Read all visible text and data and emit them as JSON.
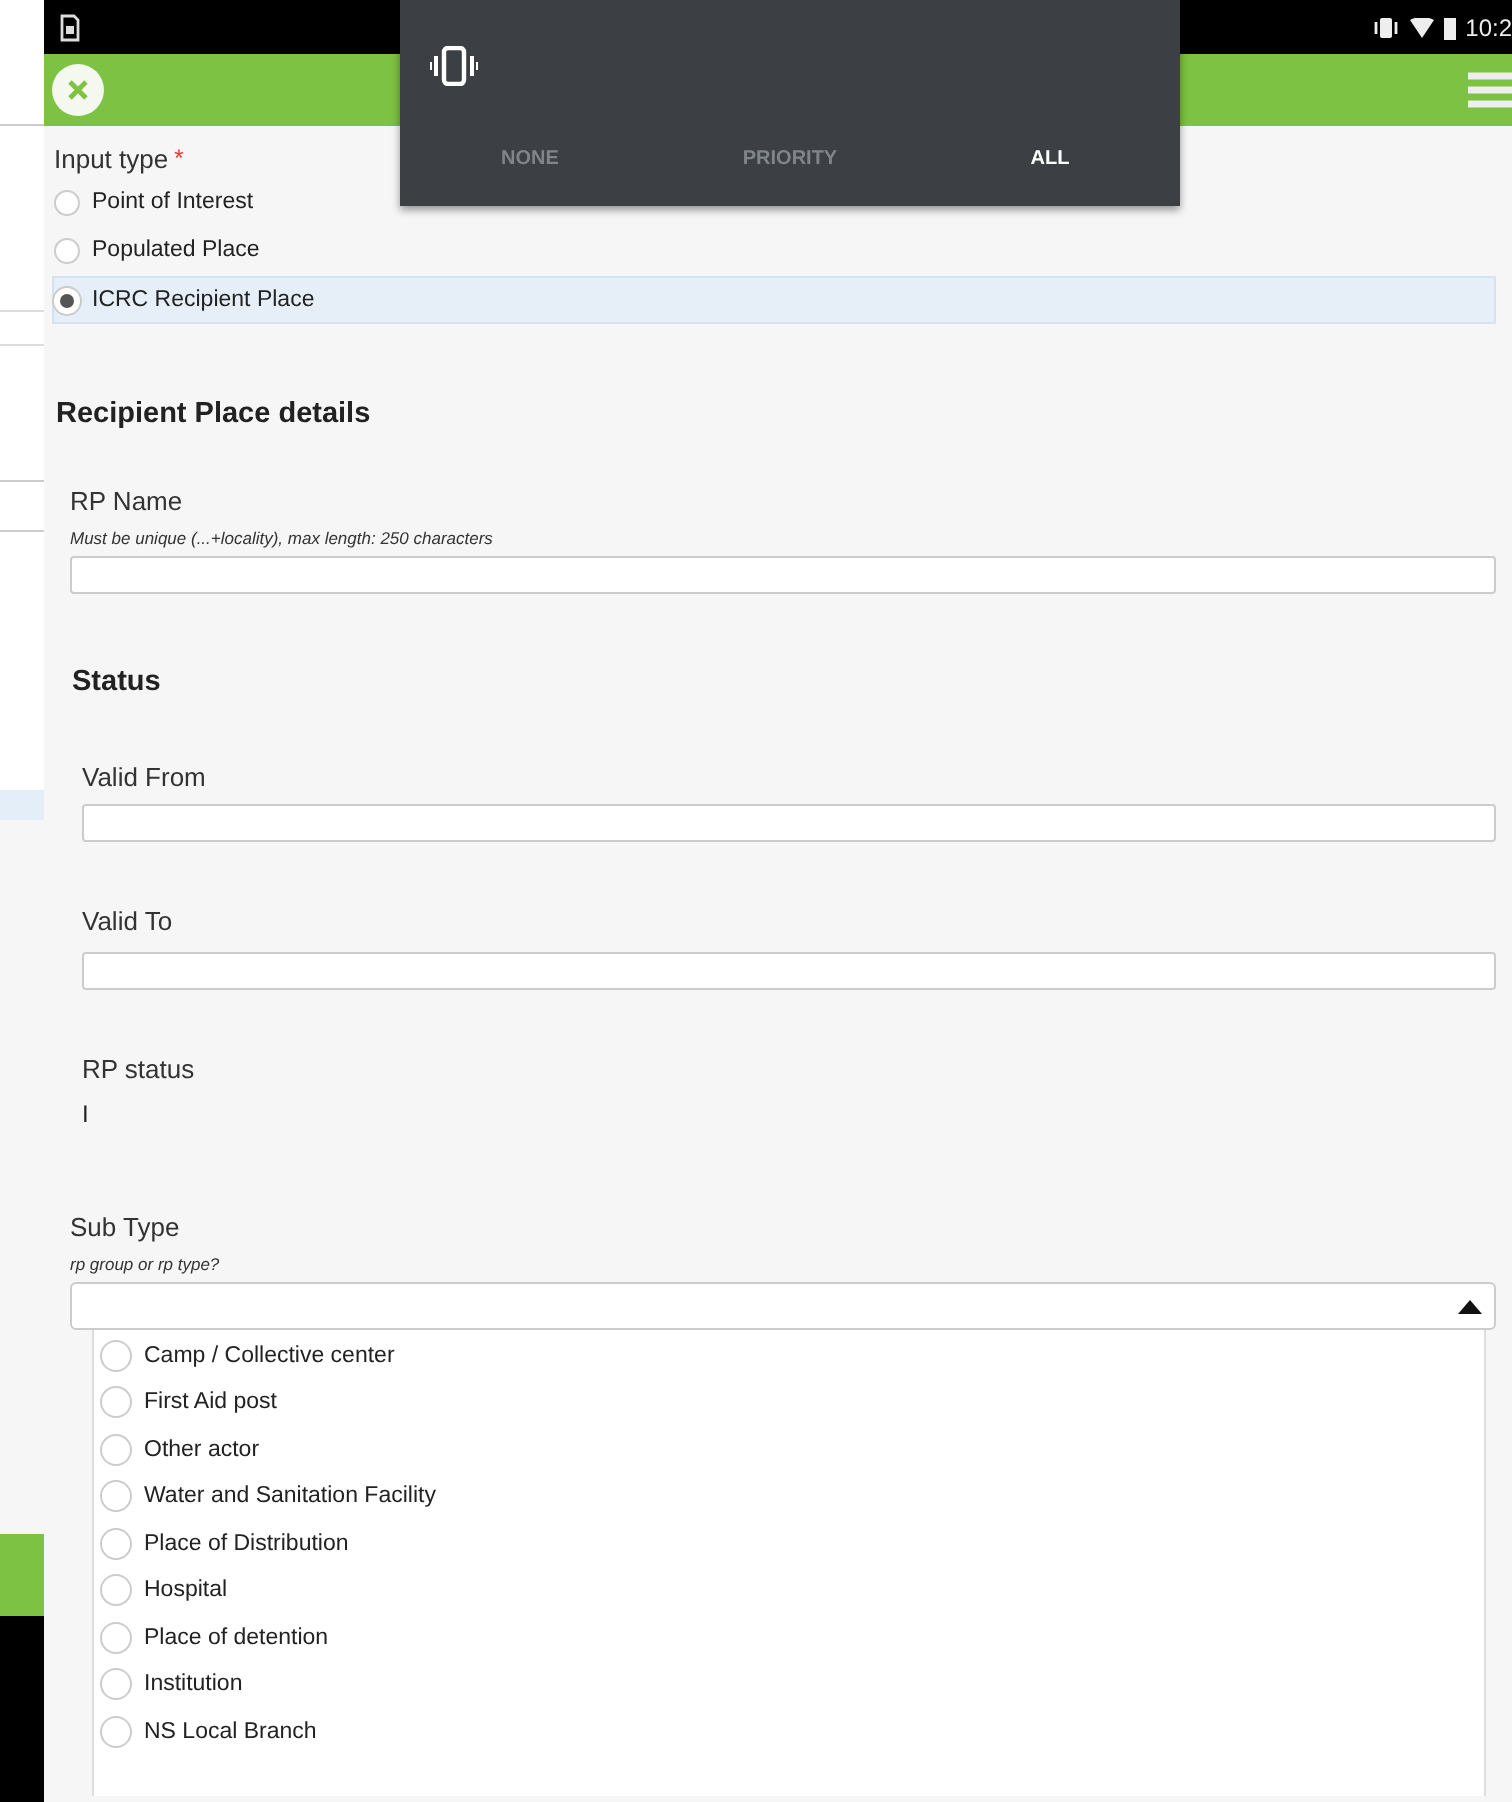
{
  "status_bar": {
    "time": "10:2"
  },
  "volume_popup": {
    "modes": [
      {
        "label": "NONE",
        "selected": false
      },
      {
        "label": "PRIORITY",
        "selected": false
      },
      {
        "label": "ALL",
        "selected": true
      }
    ]
  },
  "form": {
    "input_type": {
      "label": "Input type",
      "required_mark": "*",
      "options": [
        {
          "label": "Point of Interest",
          "selected": false
        },
        {
          "label": "Populated Place",
          "selected": false
        },
        {
          "label": "ICRC Recipient Place",
          "selected": true
        }
      ]
    },
    "section_title": "Recipient Place details",
    "rp_name": {
      "label": "RP Name",
      "hint": "Must be unique (...+locality), max length: 250 characters"
    },
    "status_title": "Status",
    "valid_from": {
      "label": "Valid From"
    },
    "valid_to": {
      "label": "Valid To"
    },
    "rp_status": {
      "label": "RP status",
      "value": "I"
    },
    "sub_type": {
      "label": "Sub Type",
      "hint": "rp group or rp type?",
      "expanded": true,
      "options": [
        {
          "label": "Camp / Collective center",
          "selected": false
        },
        {
          "label": "First Aid post",
          "selected": false
        },
        {
          "label": "Other actor",
          "selected": false
        },
        {
          "label": "Water and Sanitation Facility",
          "selected": false
        },
        {
          "label": "Place of Distribution",
          "selected": false
        },
        {
          "label": "Hospital",
          "selected": false
        },
        {
          "label": "Place of detention",
          "selected": false
        },
        {
          "label": "Institution",
          "selected": false
        },
        {
          "label": "NS Local Branch",
          "selected": false
        }
      ]
    }
  }
}
